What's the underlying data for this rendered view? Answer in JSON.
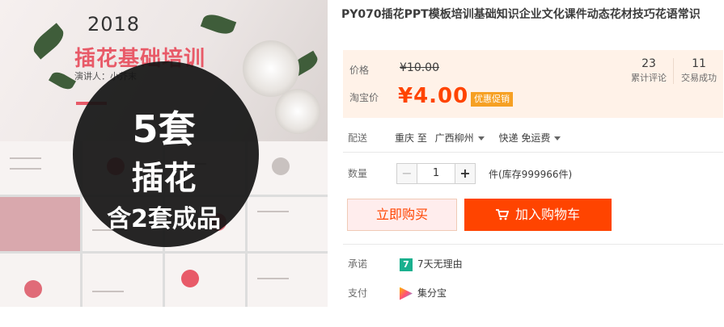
{
  "gallery": {
    "year": "2018",
    "title": "插花基础培训",
    "speaker": "演讲人：小芥末",
    "overlay_line1": "5套",
    "overlay_line2": "插花",
    "overlay_line3": "含2套成品"
  },
  "product": {
    "title": "PY070插花PPT模板培训基础知识企业文化课件动态花材技巧花语常识"
  },
  "price": {
    "label": "价格",
    "original": "¥10.00",
    "taobao_label": "淘宝价",
    "current": "¥4.00",
    "promo": "优惠促销"
  },
  "stats": [
    {
      "number": "23",
      "label": "累计评论"
    },
    {
      "number": "11",
      "label": "交易成功"
    }
  ],
  "delivery": {
    "label": "配送",
    "from": "重庆 至",
    "to": "广西柳州",
    "method": "快递 免运费"
  },
  "quantity": {
    "label": "数量",
    "value": "1",
    "minus": "−",
    "plus": "+",
    "stock": "件(库存999966件)"
  },
  "actions": {
    "buy_now": "立即购买",
    "add_to_cart": "加入购物车"
  },
  "promise": {
    "label": "承诺",
    "icon_text": "7",
    "text": "7天无理由"
  },
  "payment": {
    "label": "支付",
    "text": "集分宝"
  },
  "colors": {
    "accent": "#ff4400",
    "price_bg": "#fff2e8",
    "promo_bg": "#f6a023"
  }
}
